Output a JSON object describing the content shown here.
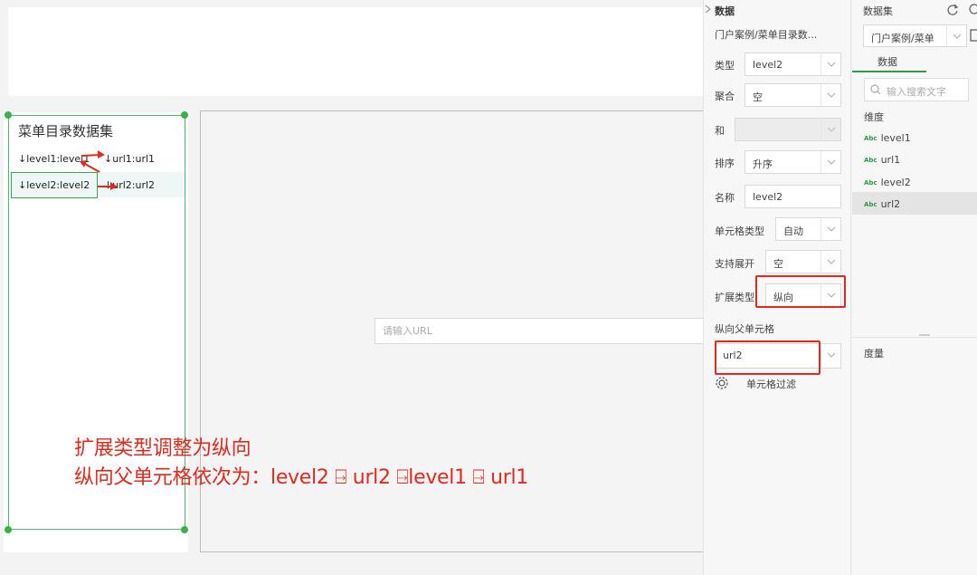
{
  "left_widget": {
    "title": "菜单目录数据集",
    "cells": [
      {
        "a": "↓level1:level1",
        "b": "↓url1:url1"
      },
      {
        "a": "↓level2:level2",
        "b": "↓url2:url2"
      }
    ]
  },
  "canvas": {
    "url_placeholder": "请输入URL"
  },
  "annotations": {
    "line1": "扩展类型调整为纵向",
    "line2": "纵向父单元格依次为：level2 ⍈ url2 ⍈level1 ⍈ url1"
  },
  "props": {
    "title": "数据",
    "dataset_path": "门户案例/菜单目录数...",
    "type_label": "类型",
    "type_value": "level2",
    "agg_label": "聚合",
    "agg_value": "空",
    "sum_label": "和",
    "sum_value": "",
    "sort_label": "排序",
    "sort_value": "升序",
    "name_label": "名称",
    "name_value": "level2",
    "cell_type_label": "单元格类型",
    "cell_type_value": "自动",
    "expand_label": "支持展开",
    "expand_value": "空",
    "expand_type_label": "扩展类型",
    "expand_type_value": "纵向",
    "parent_cell_label": "纵向父单元格",
    "parent_cell_value": "url2",
    "cell_filter_label": "单元格过滤"
  },
  "dataset": {
    "title": "数据集",
    "select_value": "门户案例/菜单",
    "tab": "数据",
    "search_placeholder": "输入搜索文字",
    "dimension_label": "维度",
    "fields": [
      "level1",
      "url1",
      "level2",
      "url2"
    ],
    "field_type_icon": "Abc",
    "measure_label": "度量"
  },
  "colors": {
    "accent_green": "#37b34a",
    "annotation_red": "#e02a1d"
  }
}
